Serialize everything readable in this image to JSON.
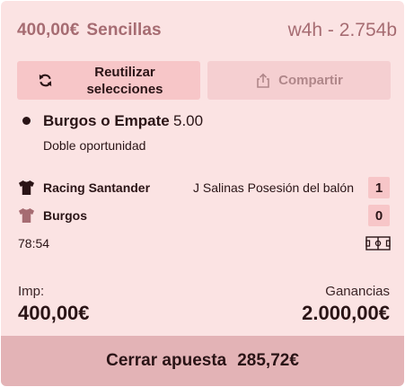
{
  "header": {
    "stake": "400,00€",
    "bet_type": "Sencillas",
    "code": "w4h - 2.754b"
  },
  "buttons": {
    "reuse": "Reutilizar selecciones",
    "share": "Compartir"
  },
  "selection": {
    "name": "Burgos o Empate",
    "odds": "5.00",
    "market": "Doble oportunidad"
  },
  "event": {
    "home": {
      "team": "Racing Santander",
      "score": "1",
      "shirt_color": "#2a1416"
    },
    "away": {
      "team": "Burgos",
      "score": "0",
      "shirt_color": "#a66c72"
    },
    "description": "J Salinas Posesión del balón",
    "clock": "78:54"
  },
  "stake": {
    "label": "Imp:",
    "value": "400,00€"
  },
  "winnings": {
    "label": "Ganancias",
    "value": "2.000,00€"
  },
  "cashout": {
    "label": "Cerrar apuesta",
    "amount": "285,72€"
  }
}
